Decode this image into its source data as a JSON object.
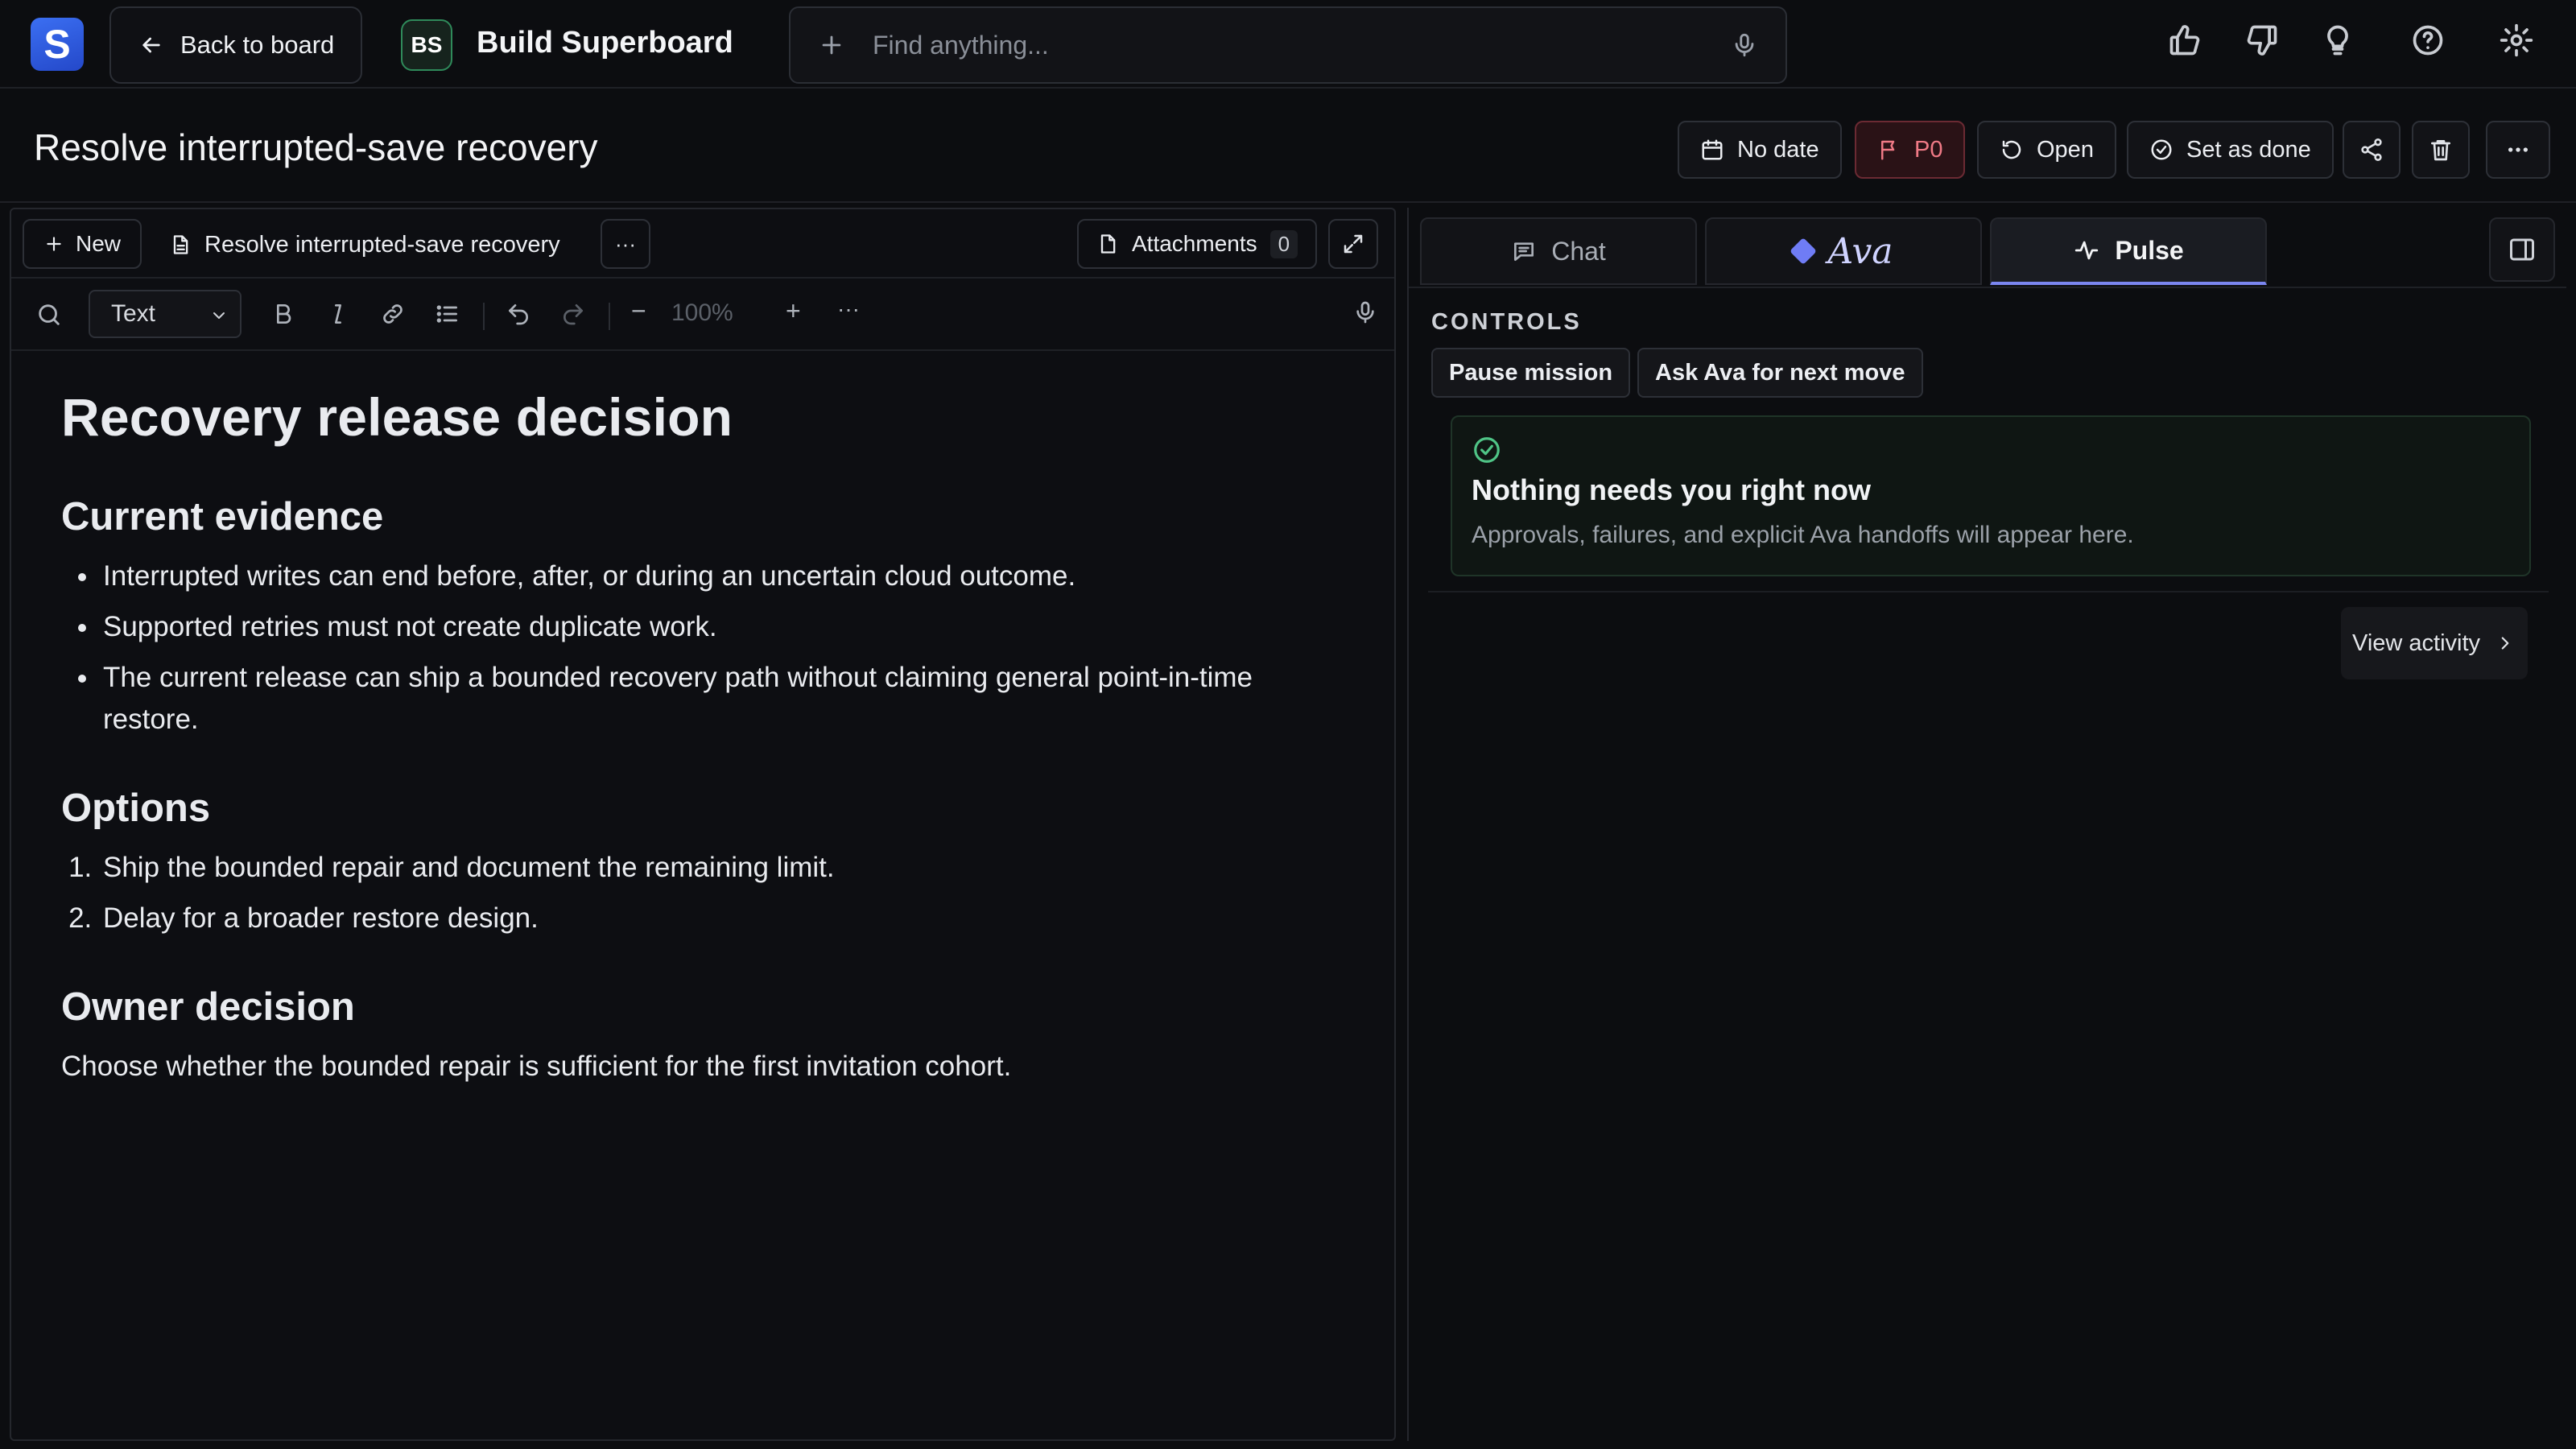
{
  "app": {
    "logo_letter": "S",
    "back_label": "Back to board",
    "workspace_badge": "BS",
    "workspace_name": "Build Superboard"
  },
  "search": {
    "placeholder": "Find anything..."
  },
  "task": {
    "title": "Resolve interrupted-save recovery",
    "date_label": "No date",
    "priority_label": "P0",
    "status_label": "Open",
    "done_label": "Set as done"
  },
  "editor": {
    "new_label": "New",
    "doc_tab_label": "Resolve interrupted-save recovery",
    "more_glyph": "···",
    "attachments_label": "Attachments",
    "attachments_count": "0",
    "text_style": "Text",
    "zoom_level": "100%",
    "zoom_minus": "−",
    "zoom_plus": "+",
    "toolbar_more": "···"
  },
  "document": {
    "h1": "Recovery release decision",
    "sections": [
      {
        "heading": "Current evidence",
        "bullets": [
          "Interrupted writes can end before, after, or during an uncertain cloud outcome.",
          "Supported retries must not create duplicate work.",
          "The current release can ship a bounded recovery path without claiming general point-in-time restore."
        ]
      },
      {
        "heading": "Options",
        "numbered": [
          "Ship the bounded repair and document the remaining limit.",
          "Delay for a broader restore design."
        ]
      },
      {
        "heading": "Owner decision",
        "paragraph": "Choose whether the bounded repair is sufficient for the first invitation cohort."
      }
    ]
  },
  "right_panel": {
    "tabs": [
      {
        "label": "Chat",
        "icon": "chat-icon"
      },
      {
        "label": "Ava",
        "icon": "ava-diamond-icon"
      },
      {
        "label": "Pulse",
        "icon": "pulse-icon",
        "active": true
      }
    ],
    "controls_label": "CONTROLS",
    "pause_label": "Pause mission",
    "ask_label": "Ask Ava for next move",
    "notice_title": "Nothing needs you right now",
    "notice_sub": "Approvals, failures, and explicit Ava handoffs will appear here.",
    "view_activity_label": "View activity"
  },
  "colors": {
    "accent": "#7b86f0",
    "priority": "#f07a86",
    "success": "#4fc486",
    "background": "#0c0d10"
  }
}
